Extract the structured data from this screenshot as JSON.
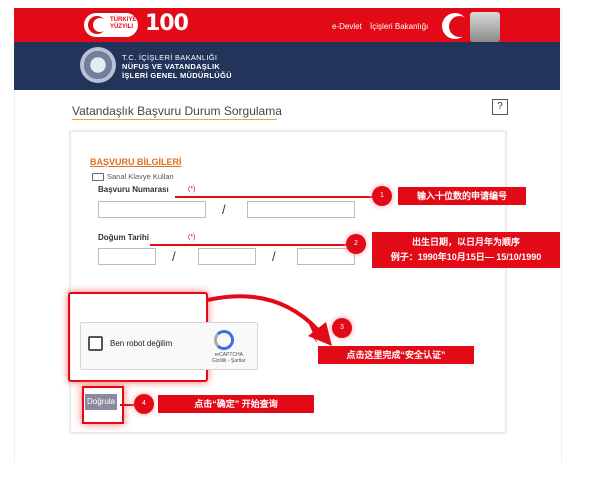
{
  "header": {
    "badge_line1": "TÜRKIYE",
    "badge_line2": "YÜZYILI",
    "centenary": "100",
    "edevlet_link": "e-Devlet",
    "ministry_link": "İçişleri Bakanlığı"
  },
  "ministry": {
    "line1": "T.C. İÇİŞLERİ BAKANLIĞI",
    "line2": "NÜFUS VE VATANDAŞLIK",
    "line3": "İŞLERİ GENEL MÜDÜRLÜĞÜ"
  },
  "page": {
    "title": "Vatandaşlık Başvuru Durum Sorgulama",
    "help": "?"
  },
  "form": {
    "section_title": "BAŞVURU BİLGİLERİ",
    "virtual_keyboard": "Sanal Klavye Kullan",
    "application_number_label": "Başvuru Numarası",
    "birth_date_label": "Doğum Tarihi",
    "required_mark": "(*)",
    "separator": "/",
    "captcha_label": "Ben robot değilim",
    "captcha_brand": "reCAPTCHA",
    "captcha_terms": "Gizlilik - Şartlar",
    "verify_button": "Doğrula"
  },
  "annotations": {
    "step1_number": "1",
    "step1_text": "输入十位数的申请编号",
    "step2_number": "2",
    "step2_line1": "出生日期，以日月年为顺序",
    "step2_line2": "例子：1990年10月15日— 15/10/1990",
    "step3_number": "3",
    "step3_text": "点击这里完成“安全认证”",
    "step4_number": "4",
    "step4_text": "点击“确定” 开始查询"
  },
  "colors": {
    "brand_red": "#e30a17",
    "navy": "#22345a",
    "accent_orange": "#e07020"
  }
}
